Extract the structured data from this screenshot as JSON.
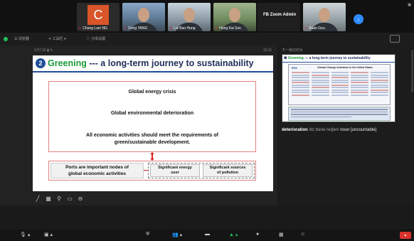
{
  "gallery": {
    "participants": [
      {
        "name": "Chung Lam NG",
        "initial": "C",
        "type": "avatar"
      },
      {
        "name": "Dong YANG",
        "type": "video"
      },
      {
        "name": "Lai Bao Hung",
        "type": "video"
      },
      {
        "name": "Hung Kai Sze",
        "type": "video"
      },
      {
        "name": "FB Zoom Admin",
        "type": "name-only"
      },
      {
        "name": "Xuan Gou",
        "type": "video"
      }
    ],
    "next_label": "›"
  },
  "subbar": {
    "items": [
      "☰ 浏览器",
      "✦ 工具栏 ▾",
      "▷ 分享设置"
    ]
  },
  "slide_status": {
    "left": "0:07:32  ▮  ↻",
    "right": "10:11"
  },
  "slide": {
    "number": "2",
    "title_green": "Greening",
    "title_rest": " --- a long-term journey to sustainability",
    "line1": "Global energy crisis",
    "line2": "Global environmental deterioration",
    "line3a": "All economic activities should meet the requirements of",
    "line3b": "green/sustainable development.",
    "ports_a": "Ports are important nodes of",
    "ports_b": "global economic activities",
    "sub1_a": "Significant energy",
    "sub1_b": "user",
    "sub2_a": "Significant sources",
    "sub2_b": "of pollution"
  },
  "panel": {
    "label": "下一张幻灯片",
    "thumb_title_green": "Greening",
    "thumb_title_rest": " --- a long-term journey to sustainability",
    "thumb_logo": "EPA",
    "thumb_chart_title": "Climate Change Indicators in the United States",
    "dict_word": "deterioration",
    "dict_ipa": " /dɪˌtɪəriəˈreɪʃən/ ",
    "dict_pos": "noun [uncountable]"
  },
  "colors": {
    "zoom_blue": "#2d8cff",
    "green_accent": "#1c9a3a",
    "end_red": "#d9322c"
  }
}
